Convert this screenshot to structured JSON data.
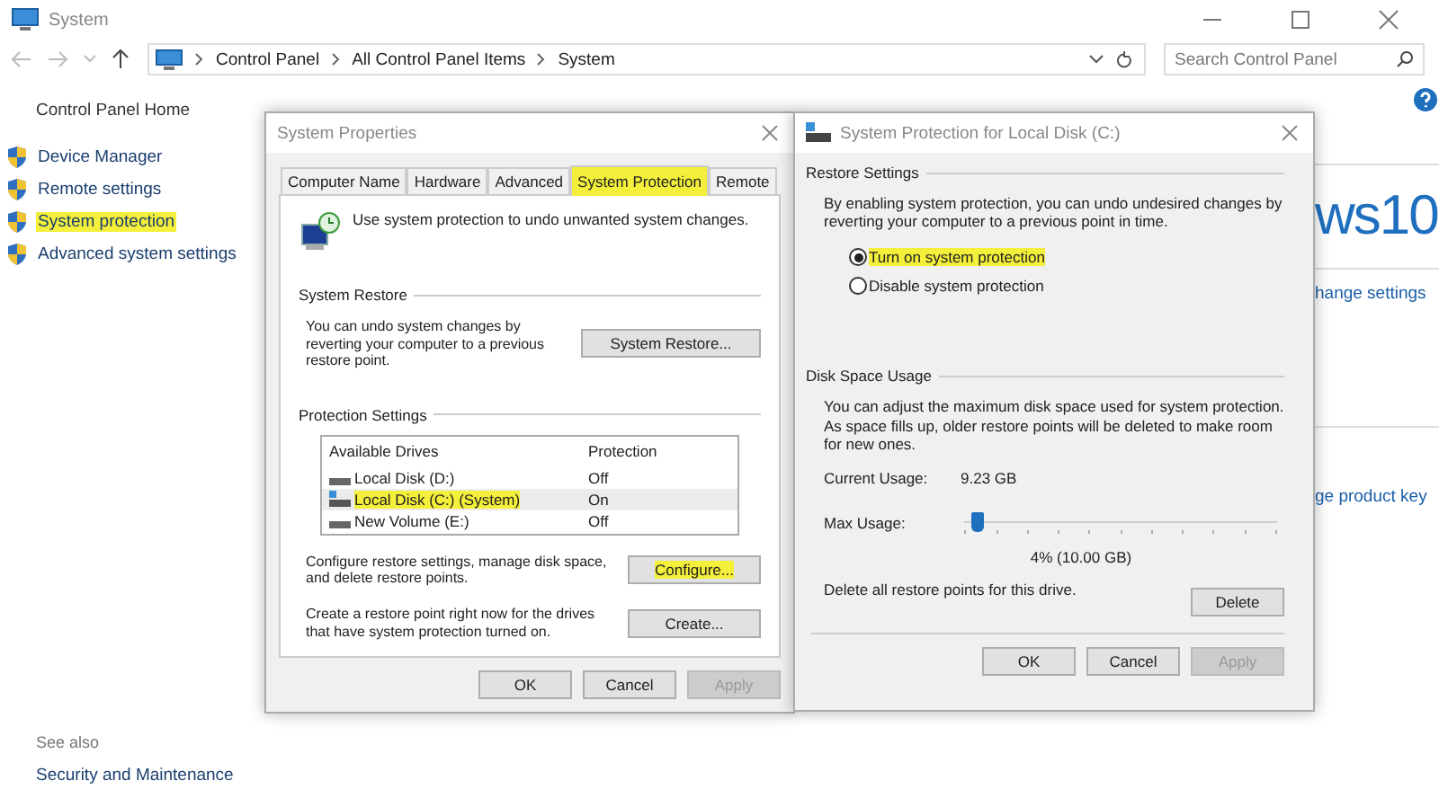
{
  "window": {
    "title": "System"
  },
  "breadcrumb": [
    "Control Panel",
    "All Control Panel Items",
    "System"
  ],
  "search": {
    "placeholder": "Search Control Panel"
  },
  "sidebar": {
    "home": "Control Panel Home",
    "items": [
      {
        "label": "Device Manager",
        "highlighted": false
      },
      {
        "label": "Remote settings",
        "highlighted": false
      },
      {
        "label": "System protection",
        "highlighted": true
      },
      {
        "label": "Advanced system settings",
        "highlighted": false
      }
    ],
    "see_also": "See also",
    "see_also_links": [
      "Security and Maintenance"
    ]
  },
  "background_fragments": {
    "brand": "ws10",
    "links": [
      "hange settings",
      "ge product key"
    ]
  },
  "system_properties": {
    "title": "System Properties",
    "tabs": [
      {
        "label": "Computer Name",
        "selected": false,
        "highlighted": false
      },
      {
        "label": "Hardware",
        "selected": false,
        "highlighted": false
      },
      {
        "label": "Advanced",
        "selected": false,
        "highlighted": false
      },
      {
        "label": "System Protection",
        "selected": true,
        "highlighted": true
      },
      {
        "label": "Remote",
        "selected": false,
        "highlighted": false
      }
    ],
    "intro": "Use system protection to undo unwanted system changes.",
    "system_restore": {
      "heading": "System Restore",
      "text": "You can undo system changes by reverting your computer to a previous restore point.",
      "button": "System Restore..."
    },
    "protection_settings": {
      "heading": "Protection Settings",
      "columns": [
        "Available Drives",
        "Protection"
      ],
      "drives": [
        {
          "name": "Local Disk (D:)",
          "protection": "Off",
          "kind": "disk",
          "selected": false,
          "highlighted": false
        },
        {
          "name": "Local Disk (C:) (System)",
          "protection": "On",
          "kind": "system",
          "selected": true,
          "highlighted": true
        },
        {
          "name": "New Volume (E:)",
          "protection": "Off",
          "kind": "disk",
          "selected": false,
          "highlighted": false
        }
      ],
      "configure": {
        "text": "Configure restore settings, manage disk space, and delete restore points.",
        "button": "Configure...",
        "highlighted": true
      },
      "create": {
        "text": "Create a restore point right now for the drives that have system protection turned on.",
        "button": "Create..."
      }
    },
    "buttons": [
      {
        "label": "OK",
        "disabled": false
      },
      {
        "label": "Cancel",
        "disabled": false
      },
      {
        "label": "Apply",
        "disabled": true
      }
    ]
  },
  "protection_dialog": {
    "title": "System Protection for Local Disk (C:)",
    "restore_settings": {
      "heading": "Restore Settings",
      "text": "By enabling system protection, you can undo undesired changes by reverting your computer to a previous point in time.",
      "options": [
        {
          "label": "Turn on system protection",
          "selected": true,
          "highlighted": true
        },
        {
          "label": "Disable system protection",
          "selected": false,
          "highlighted": false
        }
      ]
    },
    "disk_space": {
      "heading": "Disk Space Usage",
      "text": "You can adjust the maximum disk space used for system protection. As space fills up, older restore points will be deleted to make room for new ones.",
      "current_label": "Current Usage:",
      "current_value": "9.23 GB",
      "max_label": "Max Usage:",
      "level": 0.04,
      "reading": "4% (10.00 GB)",
      "delete_text": "Delete all restore points for this drive.",
      "delete_button": "Delete"
    },
    "buttons": [
      {
        "label": "OK",
        "disabled": false
      },
      {
        "label": "Cancel",
        "disabled": false
      },
      {
        "label": "Apply",
        "disabled": true
      }
    ]
  }
}
